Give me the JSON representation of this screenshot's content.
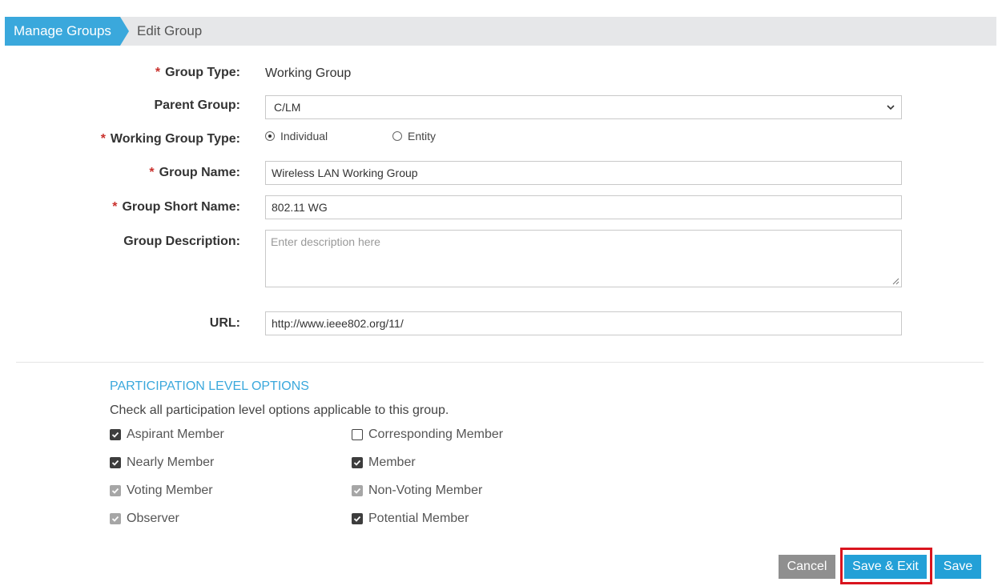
{
  "breadcrumb": {
    "parent": "Manage Groups",
    "current": "Edit Group"
  },
  "form": {
    "group_type": {
      "label": "Group Type:",
      "value": "Working Group",
      "required": true
    },
    "parent_group": {
      "label": "Parent Group:",
      "value": "C/LM"
    },
    "working_group_type": {
      "label": "Working Group Type:",
      "required": true,
      "options": [
        {
          "label": "Individual",
          "checked": true
        },
        {
          "label": "Entity",
          "checked": false
        }
      ]
    },
    "group_name": {
      "label": "Group Name:",
      "value": "Wireless LAN Working Group",
      "required": true
    },
    "group_short_name": {
      "label": "Group Short Name:",
      "value": "802.11 WG",
      "required": true
    },
    "group_description": {
      "label": "Group Description:",
      "placeholder": "Enter description here",
      "value": ""
    },
    "url": {
      "label": "URL:",
      "value": "http://www.ieee802.org/11/"
    },
    "required_mark": "*"
  },
  "participation": {
    "title": "PARTICIPATION LEVEL OPTIONS",
    "description": "Check all participation level options applicable to this group.",
    "options": [
      {
        "label": "Aspirant Member",
        "state": "checked"
      },
      {
        "label": "Corresponding Member",
        "state": "unchecked"
      },
      {
        "label": "Nearly Member",
        "state": "checked"
      },
      {
        "label": "Member",
        "state": "checked"
      },
      {
        "label": "Voting Member",
        "state": "checked-disabled"
      },
      {
        "label": "Non-Voting Member",
        "state": "checked-disabled"
      },
      {
        "label": "Observer",
        "state": "checked-disabled"
      },
      {
        "label": "Potential Member",
        "state": "checked"
      }
    ]
  },
  "buttons": {
    "cancel": "Cancel",
    "save_exit": "Save & Exit",
    "save": "Save"
  },
  "colors": {
    "accent": "#3aa8dc",
    "primary_button": "#23a0d7",
    "cancel_button": "#8f8f8f",
    "required": "#c9302c",
    "highlight": "#d9141e"
  }
}
